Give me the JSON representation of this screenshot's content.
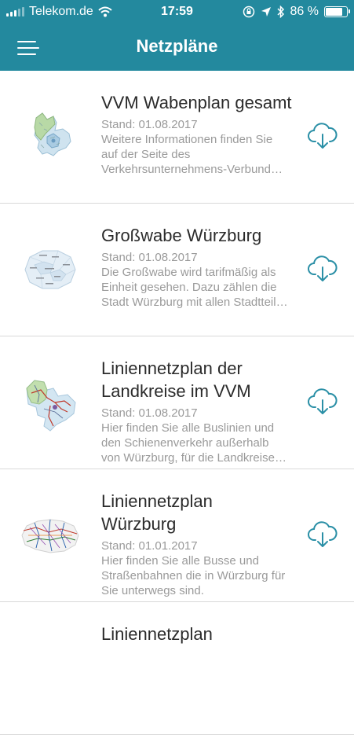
{
  "statusbar": {
    "carrier": "Telekom.de",
    "time": "17:59",
    "battery": "86 %",
    "battery_level": 0.86
  },
  "navbar": {
    "title": "Netzpläne"
  },
  "items": [
    {
      "title_lines": [
        "VVM Wabenplan gesamt"
      ],
      "stand": "Stand: 01.08.2017",
      "desc_lines": [
        "Weitere Informationen finden Sie",
        "auf der Seite des",
        "Verkehrsunternehmens-Verbund…"
      ]
    },
    {
      "title_lines": [
        "Großwabe Würzburg"
      ],
      "stand": "Stand: 01.08.2017",
      "desc_lines": [
        "Die Großwabe wird tarifmäßig als",
        "Einheit gesehen. Dazu zählen die",
        "Stadt Würzburg mit allen Stadtteil…"
      ]
    },
    {
      "title_lines": [
        "Liniennetzplan der",
        "Landkreise im VVM"
      ],
      "stand": "Stand: 01.08.2017",
      "desc_lines": [
        "Hier finden Sie alle Buslinien und",
        "den Schienenverkehr außerhalb",
        "von Würzburg, für die Landkreise…"
      ]
    },
    {
      "title_lines": [
        "Liniennetzplan",
        "Würzburg"
      ],
      "stand": "Stand: 01.01.2017",
      "desc_lines": [
        "Hier finden Sie alle Busse und",
        "Straßenbahnen die in Würzburg für",
        "Sie unterwegs sind."
      ]
    },
    {
      "title_lines": [
        "Liniennetzplan"
      ],
      "stand": "",
      "desc_lines": []
    }
  ],
  "colors": {
    "brand": "#23899e",
    "title_text": "#2b2b2b",
    "secondary_text": "#9a9a9a",
    "icon": "#2a8fa6"
  },
  "icons": {
    "menu": "hamburger-icon",
    "download": "cloud-download-icon"
  }
}
